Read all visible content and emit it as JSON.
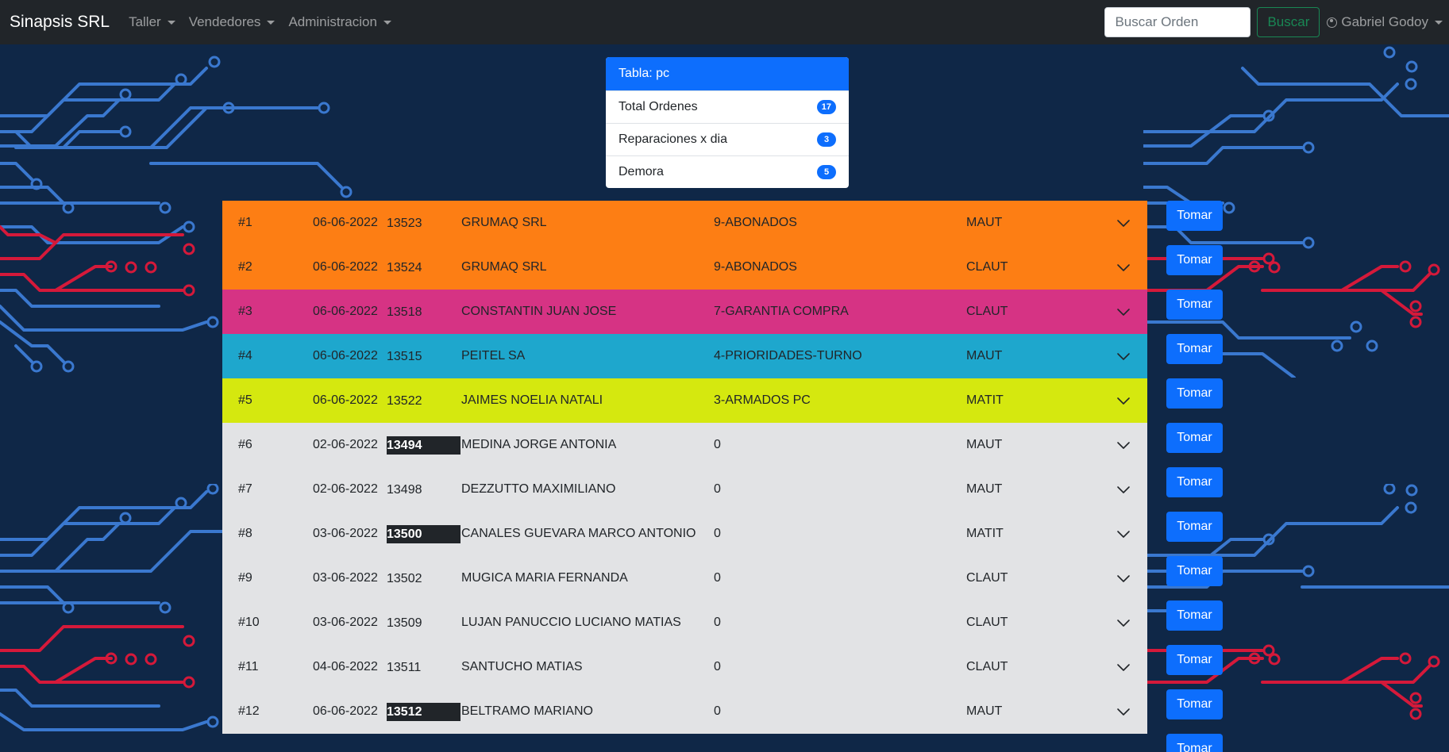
{
  "navbar": {
    "brand": "Sinapsis SRL",
    "menus": [
      "Taller",
      "Vendedores",
      "Administracion"
    ],
    "search_placeholder": "Buscar Orden",
    "search_button": "Buscar",
    "user_name": "Gabriel Godoy",
    "user_icon": "person-circle-icon"
  },
  "stats": {
    "title": "Tabla: pc",
    "rows": [
      {
        "label": "Total Ordenes",
        "value": "17"
      },
      {
        "label": "Reparaciones x dia",
        "value": "3"
      },
      {
        "label": "Demora",
        "value": "5"
      }
    ]
  },
  "orders": [
    {
      "num": "#1",
      "date": "06-06-2022",
      "order": "13523",
      "client": "GRUMAQ SRL",
      "category": "9-ABONADOS",
      "tech": "MAUT",
      "color": "#fd7e14",
      "highlight": false
    },
    {
      "num": "#2",
      "date": "06-06-2022",
      "order": "13524",
      "client": "GRUMAQ SRL",
      "category": "9-ABONADOS",
      "tech": "CLAUT",
      "color": "#fd7e14",
      "highlight": false
    },
    {
      "num": "#3",
      "date": "06-06-2022",
      "order": "13518",
      "client": "CONSTANTIN JUAN JOSE",
      "category": "7-GARANTIA COMPRA",
      "tech": "CLAUT",
      "color": "#d63384",
      "highlight": false
    },
    {
      "num": "#4",
      "date": "06-06-2022",
      "order": "13515",
      "client": "PEITEL SA",
      "category": "4-PRIORIDADES-TURNO",
      "tech": "MAUT",
      "color": "#1ea7cd",
      "highlight": false
    },
    {
      "num": "#5",
      "date": "06-06-2022",
      "order": "13522",
      "client": "JAIMES NOELIA NATALI",
      "category": "3-ARMADOS PC",
      "tech": "MATIT",
      "color": "#d5e80f",
      "highlight": false
    },
    {
      "num": "#6",
      "date": "02-06-2022",
      "order": "13494",
      "client": "MEDINA JORGE ANTONIA",
      "category": "0",
      "tech": "MAUT",
      "color": "#e2e3e5",
      "highlight": true
    },
    {
      "num": "#7",
      "date": "02-06-2022",
      "order": "13498",
      "client": "DEZZUTTO MAXIMILIANO",
      "category": "0",
      "tech": "MAUT",
      "color": "#e2e3e5",
      "highlight": false
    },
    {
      "num": "#8",
      "date": "03-06-2022",
      "order": "13500",
      "client": "CANALES GUEVARA MARCO ANTONIO",
      "category": "0",
      "tech": "MATIT",
      "color": "#e2e3e5",
      "highlight": true
    },
    {
      "num": "#9",
      "date": "03-06-2022",
      "order": "13502",
      "client": "MUGICA MARIA FERNANDA",
      "category": "0",
      "tech": "CLAUT",
      "color": "#e2e3e5",
      "highlight": false
    },
    {
      "num": "#10",
      "date": "03-06-2022",
      "order": "13509",
      "client": "LUJAN PANUCCIO LUCIANO MATIAS",
      "category": "0",
      "tech": "CLAUT",
      "color": "#e2e3e5",
      "highlight": false
    },
    {
      "num": "#11",
      "date": "04-06-2022",
      "order": "13511",
      "client": "SANTUCHO MATIAS",
      "category": "0",
      "tech": "CLAUT",
      "color": "#e2e3e5",
      "highlight": false
    },
    {
      "num": "#12",
      "date": "06-06-2022",
      "order": "13512",
      "client": "BELTRAMO MARIANO",
      "category": "0",
      "tech": "MAUT",
      "color": "#e2e3e5",
      "highlight": true
    }
  ],
  "tomar_label": "Tomar",
  "tomar_count": 13,
  "expand_icon": "chevron-down-icon"
}
